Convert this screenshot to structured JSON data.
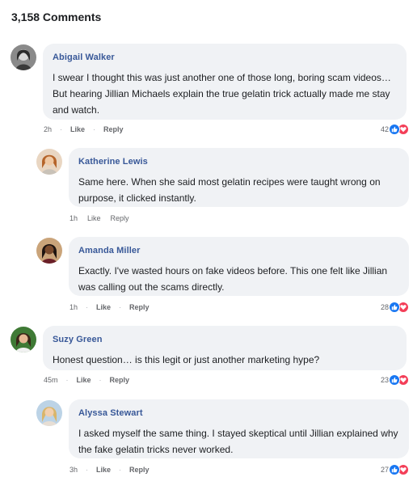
{
  "header": {
    "title": "3,158 Comments"
  },
  "comments": [
    {
      "author": "Abigail Walker",
      "text": "I swear I thought this was just another one of those long, boring scam videos… But hearing Jillian Michaels explain the true gelatin trick actually made me stay and watch.",
      "time": "2h",
      "like_label": "Like",
      "reply_label": "Reply",
      "count": "42",
      "avatar_icon": "avatar-grayscale-woman"
    },
    {
      "author": "Katherine Lewis",
      "text": "Same here. When she said most gelatin recipes were taught wrong on purpose, it clicked instantly.",
      "time": "1h",
      "like_label": "Like",
      "reply_label": "Reply",
      "count": "",
      "avatar_icon": "avatar-woman-orange"
    },
    {
      "author": "Amanda Miller",
      "text": "Exactly. I've wasted hours on fake videos before. This one felt like Jillian was calling out the scams directly.",
      "time": "1h",
      "like_label": "Like",
      "reply_label": "Reply",
      "count": "28",
      "avatar_icon": "avatar-woman-dark"
    },
    {
      "author": "Suzy Green",
      "text": "Honest question… is this legit or just another marketing hype?",
      "time": "45m",
      "like_label": "Like",
      "reply_label": "Reply",
      "count": "23",
      "avatar_icon": "avatar-woman-green"
    },
    {
      "author": "Alyssa Stewart",
      "text": "I asked myself the same thing. I stayed skeptical until Jillian explained why the fake gelatin tricks never worked.",
      "time": "3h",
      "like_label": "Like",
      "reply_label": "Reply",
      "count": "27",
      "avatar_icon": "avatar-woman-blonde"
    }
  ],
  "colors": {
    "like": "#1877f2",
    "love": "#f33e58",
    "bubble": "#f0f2f5",
    "author": "#385898"
  },
  "icons": {
    "like": "thumbs-up-icon",
    "love": "heart-icon"
  }
}
